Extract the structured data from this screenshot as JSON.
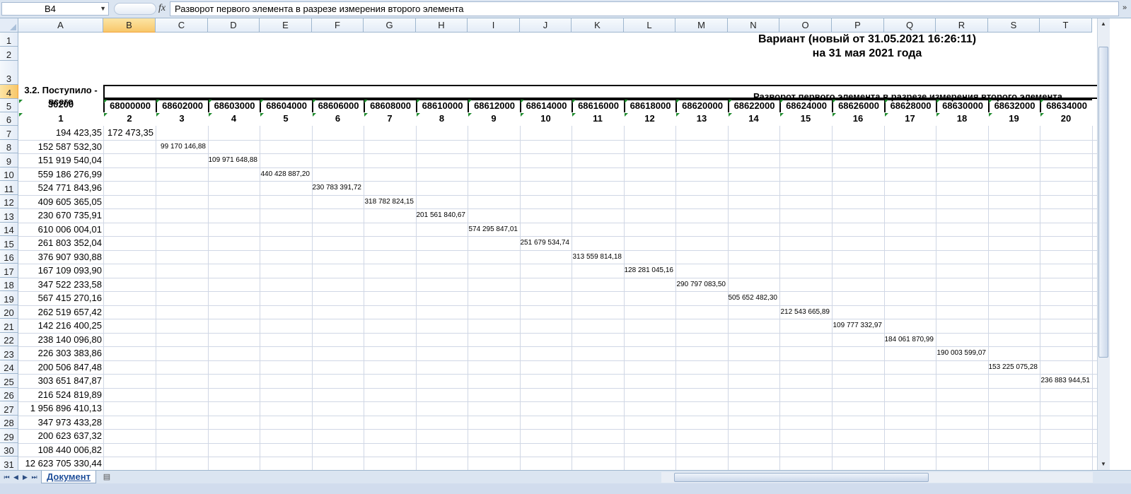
{
  "formula_bar": {
    "name_box": "B4",
    "fx_label": "fx",
    "formula": "Разворот первого элемента в разрезе измерения второго элемента"
  },
  "columns": [
    "A",
    "B",
    "C",
    "D",
    "E",
    "F",
    "G",
    "H",
    "I",
    "J",
    "K",
    "L",
    "M",
    "N",
    "O",
    "P",
    "Q",
    "R",
    "S",
    "T"
  ],
  "rows": [
    "1",
    "2",
    "3",
    "4",
    "5",
    "6",
    "7",
    "8",
    "9",
    "10",
    "11",
    "12",
    "13",
    "14",
    "15",
    "16",
    "17",
    "18",
    "19",
    "20",
    "21",
    "22",
    "23",
    "24",
    "25",
    "26",
    "27",
    "28",
    "29",
    "30",
    "31"
  ],
  "title": {
    "line1": "Вариант (новый от 31.05.2021 16:26:11)",
    "line2": "на 31 мая 2021 года"
  },
  "header_row4": {
    "a4": "3.2. Поступило - всего",
    "merged": "Разворот первого элемента в разрезе измерения второго элемента"
  },
  "codes_row5": [
    "30200",
    "68000000",
    "68602000",
    "68603000",
    "68604000",
    "68606000",
    "68608000",
    "68610000",
    "68612000",
    "68614000",
    "68616000",
    "68618000",
    "68620000",
    "68622000",
    "68624000",
    "68626000",
    "68628000",
    "68630000",
    "68632000",
    "68634000"
  ],
  "nums_row6": [
    "1",
    "2",
    "3",
    "4",
    "5",
    "6",
    "7",
    "8",
    "9",
    "10",
    "11",
    "12",
    "13",
    "14",
    "15",
    "16",
    "17",
    "18",
    "19",
    "20"
  ],
  "col_a_values": [
    "194 423,35",
    "152 587 532,30",
    "151 919 540,04",
    "559 186 276,99",
    "524 771 843,96",
    "409 605 365,05",
    "230 670 735,91",
    "610 006 004,01",
    "261 803 352,04",
    "376 907 930,88",
    "167 109 093,90",
    "347 522 233,58",
    "567 415 270,16",
    "262 519 657,42",
    "142 216 400,25",
    "238 140 096,80",
    "226 303 383,86",
    "200 506 847,48",
    "303 651 847,87",
    "216 524 819,89",
    "1 956 896 410,13",
    "347 973 433,28",
    "200 623 637,32",
    "108 440 006,82",
    "12 623 705 330,44"
  ],
  "diag_values": [
    "172 473,35",
    "99 170 146,88",
    "109 971 648,88",
    "440 428 887,20",
    "230 783 391,72",
    "318 782 824,15",
    "201 561 840,67",
    "574 295 847,01",
    "251 679 534,74",
    "313 559 814,18",
    "128 281 045,16",
    "290 797 083,50",
    "505 652 482,30",
    "212 543 665,89",
    "109 777 332,97",
    "184 061 870,99",
    "190 003 599,07",
    "153 225 075,28",
    "236 883 944,51"
  ],
  "sheet_tab": "Документ",
  "accent_color": "#f8c76a"
}
